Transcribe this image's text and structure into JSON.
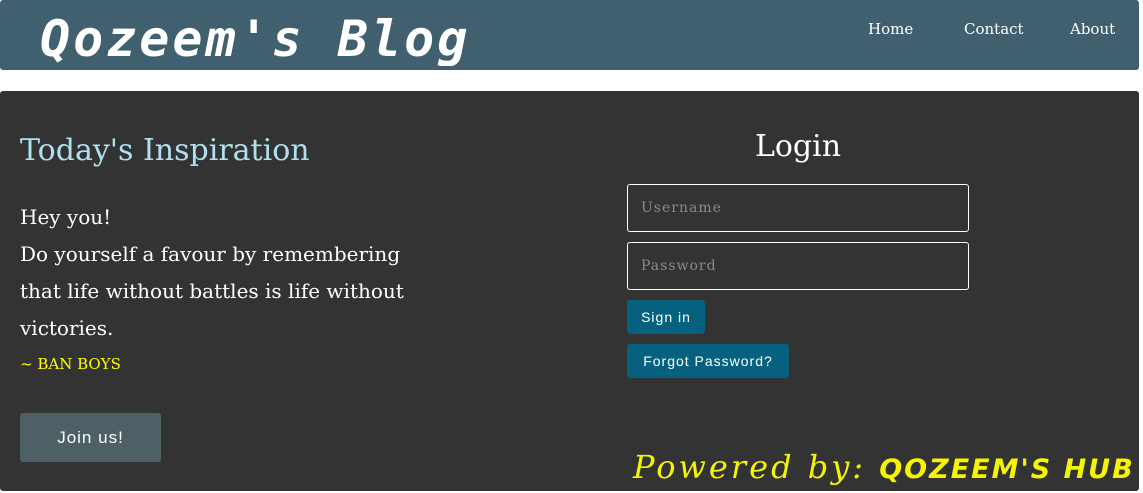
{
  "header": {
    "brand": "Qozeem's Blog",
    "nav": {
      "home": "Home",
      "contact": "Contact",
      "about": "About"
    }
  },
  "inspiration": {
    "title": "Today's Inspiration",
    "greeting": "Hey you!",
    "quote_lines": [
      "Do yourself a favour by remembering",
      "that life without battles is life without",
      "victories."
    ],
    "author": "~ BAN BOYS",
    "join_label": "Join us!"
  },
  "login": {
    "title": "Login",
    "username_placeholder": "Username",
    "password_placeholder": "Password",
    "signin_label": "Sign in",
    "forgot_label": "Forgot Password?"
  },
  "footer": {
    "powered_prefix": "Powered by: ",
    "powered_name": "QOZEEM'S HUB"
  },
  "colors": {
    "header_bg": "#41606f",
    "panel_bg": "#333333",
    "accent_title": "#aee0f0",
    "author_yellow": "#ffff00",
    "button_blue": "#05617f",
    "join_button": "#4e5f66"
  }
}
